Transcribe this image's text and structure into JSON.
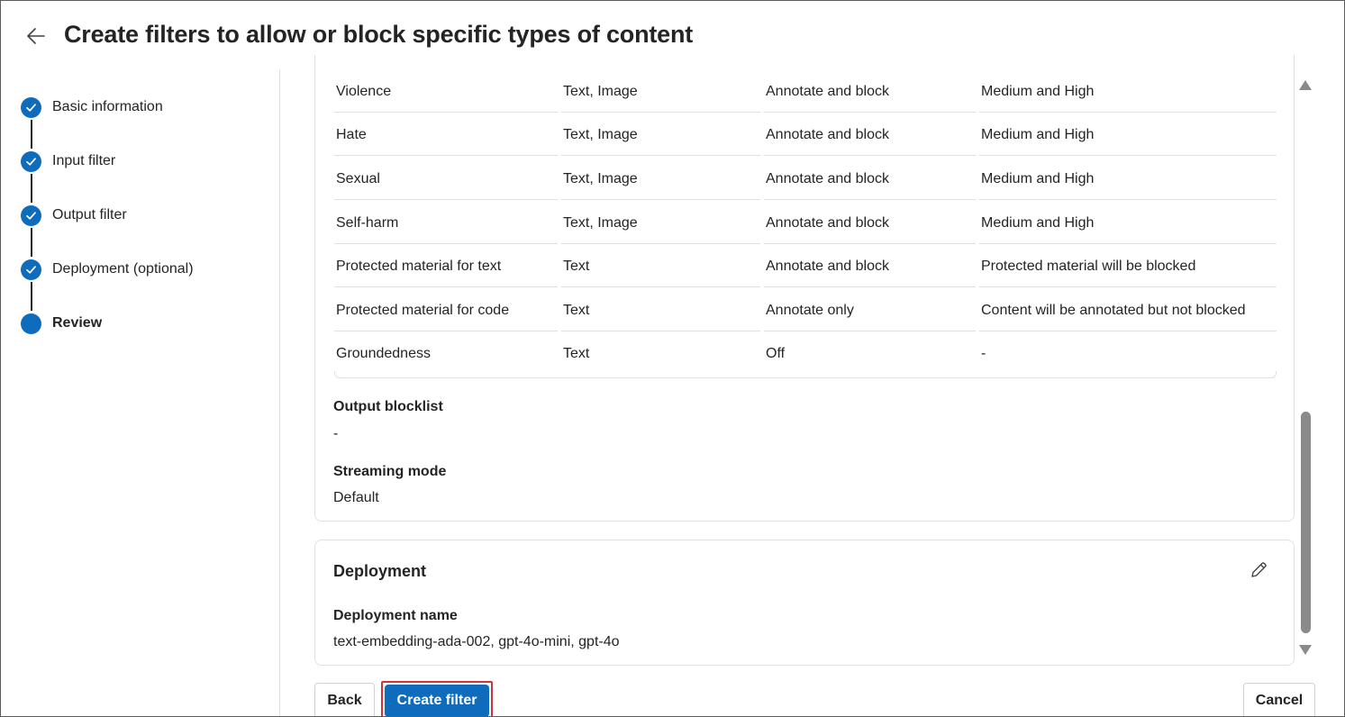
{
  "header": {
    "title": "Create filters to allow or block specific types of content"
  },
  "stepper": {
    "steps": [
      {
        "label": "Basic information",
        "status": "completed"
      },
      {
        "label": "Input filter",
        "status": "completed"
      },
      {
        "label": "Output filter",
        "status": "completed"
      },
      {
        "label": "Deployment (optional)",
        "status": "completed"
      },
      {
        "label": "Review",
        "status": "current"
      }
    ]
  },
  "output_filter_table": {
    "rows": [
      {
        "category": "Violence",
        "media": "Text, Image",
        "action": "Annotate and block",
        "threshold": "Medium and High"
      },
      {
        "category": "Hate",
        "media": "Text, Image",
        "action": "Annotate and block",
        "threshold": "Medium and High"
      },
      {
        "category": "Sexual",
        "media": "Text, Image",
        "action": "Annotate and block",
        "threshold": "Medium and High"
      },
      {
        "category": "Self-harm",
        "media": "Text, Image",
        "action": "Annotate and block",
        "threshold": "Medium and High"
      },
      {
        "category": "Protected material for text",
        "media": "Text",
        "action": "Annotate and block",
        "threshold": "Protected material will be blocked"
      },
      {
        "category": "Protected material for code",
        "media": "Text",
        "action": "Annotate only",
        "threshold": "Content will be annotated but not blocked"
      },
      {
        "category": "Groundedness",
        "media": "Text",
        "action": "Off",
        "threshold": "-"
      }
    ]
  },
  "output_blocklist": {
    "label": "Output blocklist",
    "value": "-"
  },
  "streaming_mode": {
    "label": "Streaming mode",
    "value": "Default"
  },
  "deployment": {
    "title": "Deployment",
    "name_label": "Deployment name",
    "name_value": "text-embedding-ada-002, gpt-4o-mini, gpt-4o"
  },
  "footer": {
    "back_label": "Back",
    "create_label": "Create filter",
    "cancel_label": "Cancel"
  },
  "colors": {
    "accent": "#0f6cbd",
    "highlight_outline": "#d13438"
  },
  "icons": {
    "back": "arrow-left-icon",
    "step_done": "checkmark-icon",
    "edit": "pencil-icon"
  }
}
